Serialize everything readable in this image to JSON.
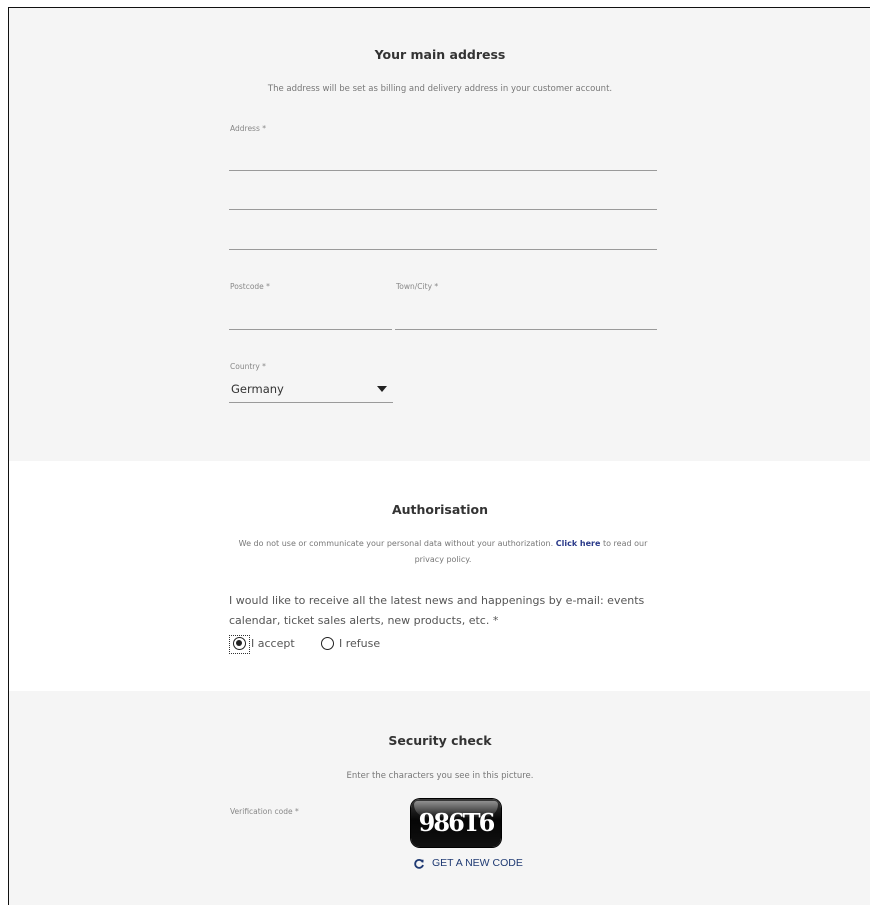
{
  "address_section": {
    "title": "Your main address",
    "subtitle": "The address will be set as billing and delivery address in your customer account.",
    "address_label": "Address *",
    "address_line1": "",
    "address_line2": "",
    "address_line3": "",
    "postcode_label": "Postcode *",
    "postcode_value": "",
    "town_label": "Town/City *",
    "town_value": "",
    "country_label": "Country *",
    "country_value": "Germany",
    "dropdown_icon": "caret-down-icon"
  },
  "authorisation": {
    "title": "Authorisation",
    "privacy_text": "We do not use or communicate your personal data without your authorization.",
    "privacy_link": "Click here",
    "privacy_tail": "to read our privacy policy.",
    "question": "I would like to receive all the latest news and happenings by e-mail: events calendar, ticket sales alerts, new products, etc. *",
    "options": [
      {
        "label": "I accept",
        "checked": true
      },
      {
        "label": "I refuse",
        "checked": false
      }
    ]
  },
  "security": {
    "title": "Security check",
    "subtitle": "Enter the characters you see in this picture.",
    "code_label": "Verification code *",
    "captcha_text": "986T6",
    "new_code_label": "GET A NEW CODE",
    "refresh_icon": "refresh-icon"
  },
  "colors": {
    "section_gray": "#f5f5f5",
    "link_blue": "#1f3a73",
    "text": "#333333"
  }
}
